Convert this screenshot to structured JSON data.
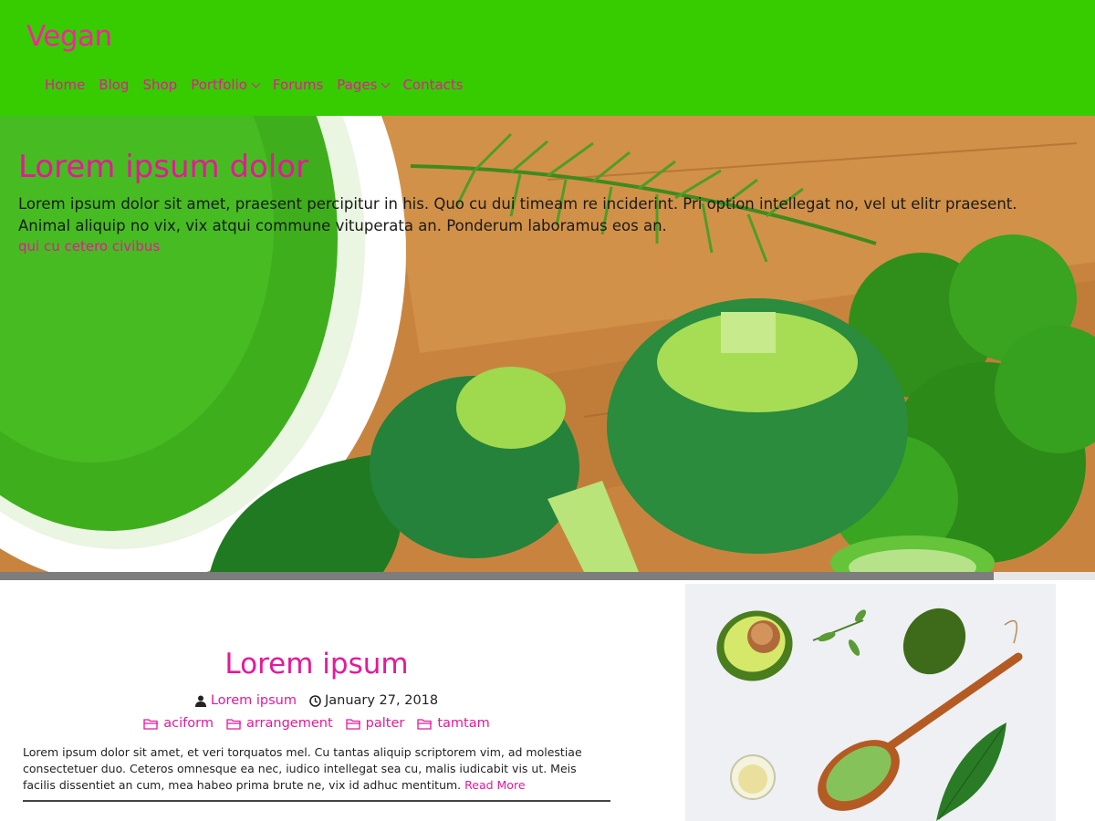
{
  "site": {
    "title": "Vegan"
  },
  "nav": {
    "items": [
      {
        "label": "Home",
        "has_dropdown": false
      },
      {
        "label": "Blog",
        "has_dropdown": false
      },
      {
        "label": "Shop",
        "has_dropdown": false
      },
      {
        "label": "Portfolio",
        "has_dropdown": true
      },
      {
        "label": "Forums",
        "has_dropdown": false
      },
      {
        "label": "Pages",
        "has_dropdown": true
      },
      {
        "label": "Contacts",
        "has_dropdown": false
      }
    ]
  },
  "hero": {
    "title": "Lorem ipsum dolor",
    "text": "Lorem ipsum dolor sit amet, praesent percipitur in his. Quo cu dui timeam re inciderint. Pri option intellegat no, vel ut elitr praesent. Animal aliquip no vix, vix atqui commune vituperata an. Ponderum laboramus eos an.",
    "link": "qui cu cetero civibus",
    "slider_progress": 0.9075
  },
  "post": {
    "title": "Lorem ipsum",
    "author": "Lorem ipsum",
    "date": "January 27, 2018",
    "categories": [
      "aciform",
      "arrangement",
      "palter",
      "tamtam"
    ],
    "excerpt": "Lorem ipsum dolor sit amet, et veri torquatos mel. Cu tantas aliquip scriptorem vim, ad molestiae consectetuer duo. Ceteros omnesque ea nec, iudico intellegat sea cu, malis iudicabit vis ut. Meis facilis dissentiet an cum, mea habeo prima brute ne, vix id adhuc mentitum.",
    "read_more": "Read More"
  },
  "icons": {
    "author": "user-icon",
    "date": "clock-icon",
    "category": "folder-icon",
    "dropdown": "chevron-down-icon"
  },
  "colors": {
    "header_bg": "#36cc00",
    "accent": "#e8179a",
    "text": "#222222"
  }
}
